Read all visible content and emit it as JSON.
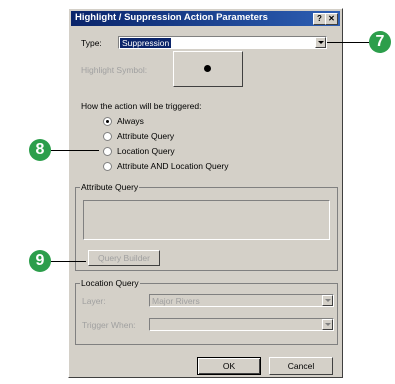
{
  "dialog": {
    "title": "Highlight / Suppression Action Parameters",
    "help_button": "?",
    "close_button": "✕"
  },
  "type_field": {
    "label": "Type:",
    "value": "Suppression"
  },
  "highlight_symbol": {
    "label": "Highlight Symbol:"
  },
  "trigger": {
    "heading": "How the action will be triggered:",
    "options": [
      "Always",
      "Attribute Query",
      "Location Query",
      "Attribute AND Location Query"
    ],
    "selected": "Always"
  },
  "attribute_query": {
    "legend": "Attribute Query",
    "builder_button": "Query Builder"
  },
  "location_query": {
    "legend": "Location Query",
    "layer_label": "Layer:",
    "layer_value": "Major Rivers",
    "trigger_when_label": "Trigger When:",
    "trigger_when_value": ""
  },
  "buttons": {
    "ok": "OK",
    "cancel": "Cancel"
  },
  "callouts": [
    "7",
    "8",
    "9"
  ],
  "colors": {
    "title_bar": "#0a246a",
    "dialog_face": "#d4d0c8",
    "callout": "#2c9e4b"
  }
}
